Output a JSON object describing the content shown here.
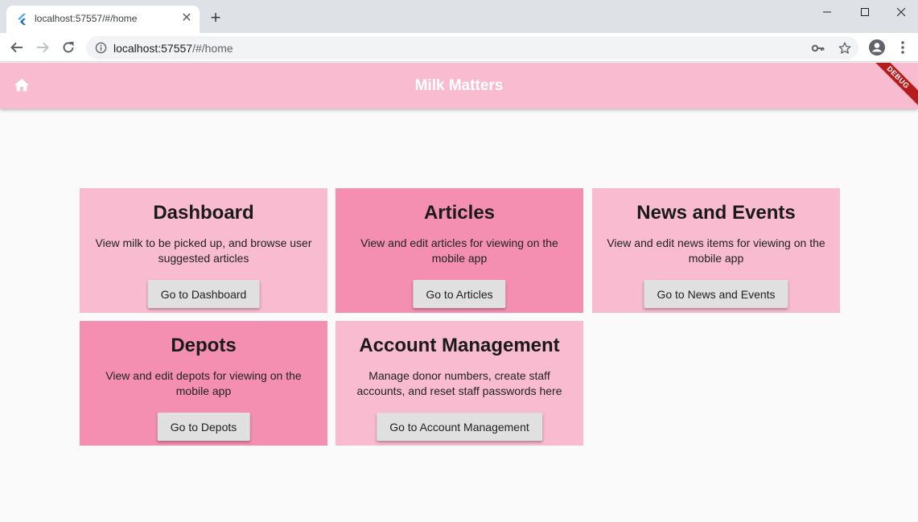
{
  "browser": {
    "tab_title": "localhost:57557/#/home",
    "url_host": "localhost:57557",
    "url_path": "/#/home"
  },
  "app": {
    "title": "Milk Matters",
    "debug_label": "DEBUG",
    "colors": {
      "appbar": "#f8bbd0",
      "card_light": "#f8bbd0",
      "card_dark": "#f48fb1",
      "button": "#e0e0e0"
    }
  },
  "cards": [
    {
      "title": "Dashboard",
      "description": "View milk to be picked up, and browse user suggested articles",
      "button": "Go to Dashboard"
    },
    {
      "title": "Articles",
      "description": "View and edit articles for viewing on the mobile app",
      "button": "Go to Articles"
    },
    {
      "title": "News and Events",
      "description": "View and edit news items for viewing on the mobile app",
      "button": "Go to News and Events"
    },
    {
      "title": "Depots",
      "description": "View and edit depots for viewing on the mobile app",
      "button": "Go to Depots"
    },
    {
      "title": "Account Management",
      "description": "Manage donor numbers, create staff accounts, and reset staff passwords here",
      "button": "Go to Account Management"
    }
  ]
}
